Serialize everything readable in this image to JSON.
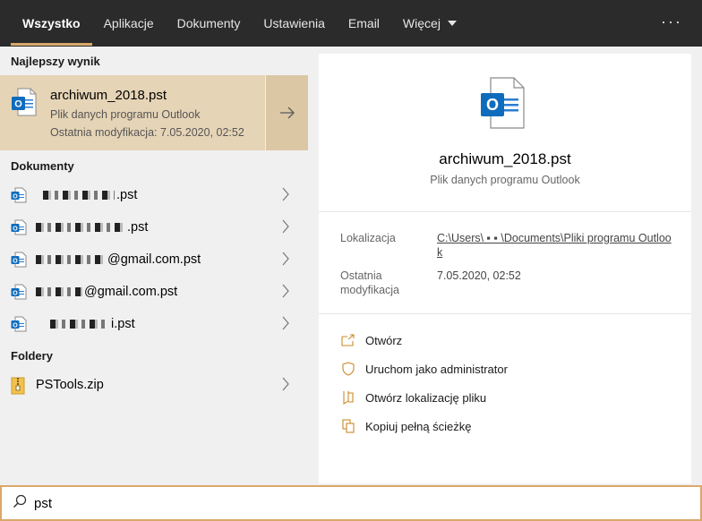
{
  "tabs": [
    {
      "label": "Wszystko",
      "active": true
    },
    {
      "label": "Aplikacje"
    },
    {
      "label": "Dokumenty"
    },
    {
      "label": "Ustawienia"
    },
    {
      "label": "Email"
    },
    {
      "label": "Więcej"
    }
  ],
  "more_icon": "ellipsis-icon",
  "best_match": {
    "section": "Najlepszy wynik",
    "name": "archiwum_2018.pst",
    "type": "Plik danych programu Outlook",
    "modified": "Ostatnia modyfikacja: 7.05.2020, 02:52"
  },
  "documents": {
    "section": "Dokumenty",
    "items": [
      {
        "suffix": ".pst"
      },
      {
        "suffix": ".pst"
      },
      {
        "suffix": "@gmail.com.pst"
      },
      {
        "suffix": "@gmail.com.pst"
      },
      {
        "suffix": "i.pst"
      }
    ]
  },
  "folders": {
    "section": "Foldery",
    "items": [
      {
        "name": "PSTools.zip"
      }
    ]
  },
  "preview": {
    "name": "archiwum_2018.pst",
    "type": "Plik danych programu Outlook",
    "location_label": "Lokalizacja",
    "location_value": "C:\\Users\\ ▪ ▪ \\Documents\\Pliki programu Outlook",
    "modified_label": "Ostatnia modyfikacja",
    "modified_value": "7.05.2020, 02:52",
    "actions": [
      {
        "label": "Otwórz",
        "icon": "open-icon"
      },
      {
        "label": "Uruchom jako administrator",
        "icon": "shield-icon"
      },
      {
        "label": "Otwórz lokalizację pliku",
        "icon": "folder-location-icon"
      },
      {
        "label": "Kopiuj pełną ścieżkę",
        "icon": "copy-icon"
      }
    ]
  },
  "search": {
    "value": "pst"
  },
  "colors": {
    "accent": "#d9a86a",
    "selected": "#e6d4b6",
    "outlook_blue": "#0f6cbd"
  }
}
